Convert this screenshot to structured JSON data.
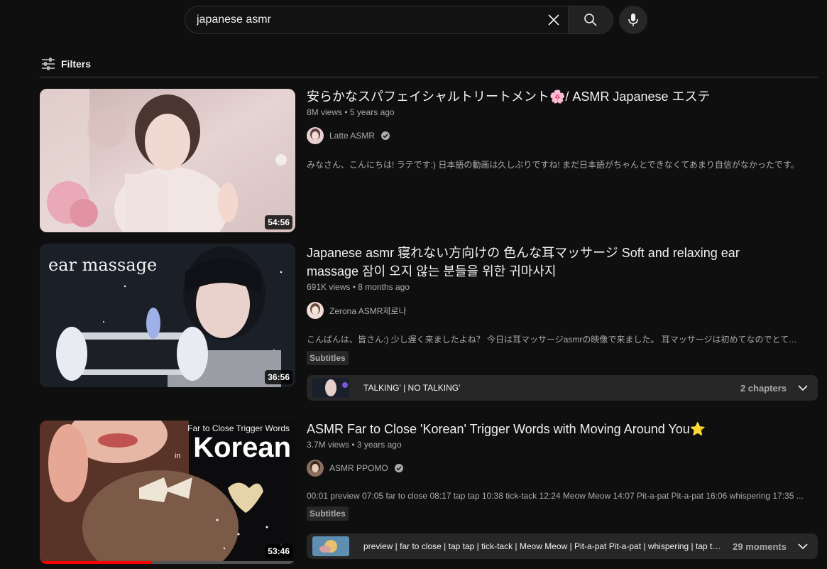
{
  "search": {
    "query": "japanese asmr"
  },
  "filters": {
    "label": "Filters"
  },
  "results": [
    {
      "title": "安らかなスパフェイシャルトリートメント🌸/ ASMR Japanese エステ",
      "views": "8M views",
      "age": "5 years ago",
      "channel": "Latte ASMR",
      "verified": true,
      "description": "みなさん、こんにちは! ラテです:) 日本語の動画は久しぶりですね! まだ日本語がちゃんとできなくてあまり自信がなかったです。",
      "duration": "54:56"
    },
    {
      "title": "Japanese asmr 寝れない方向けの 色んな耳マッサージ Soft and relaxing ear massage 잠이 오지 않는 분들을 위한 귀마사지",
      "views": "691K views",
      "age": "8 months ago",
      "channel": "Zerona ASMR제로나",
      "verified": false,
      "description": "こんばんは、皆さん:) 少し遅く来ましたよね？ 今日は耳マッサージasmrの映像で来ました。 耳マッサージは初めてなのでとても ...",
      "badge": "Subtitles",
      "thumb_text": "ear massage",
      "chapters_text": "TALKING' | NO TALKING'",
      "chapters_count": "2 chapters",
      "duration": "36:56"
    },
    {
      "title": "ASMR Far to Close 'Korean' Trigger Words with Moving Around You⭐",
      "views": "3.7M views",
      "age": "3 years ago",
      "channel": "ASMR PPOMO",
      "verified": true,
      "description": "00:01 preview 07:05 far to close 08:17 tap tap 10:38 tick-tack 12:24 Meow Meow 14:07 Pit-a-pat Pit-a-pat 16:06 whispering 17:35 ...",
      "badge": "Subtitles",
      "thumb_text_small": "Far to Close Trigger Words",
      "thumb_text_in": "in",
      "thumb_text_big": "Korean",
      "chapters_text": "preview | far to close | tap tap | tick-tack | Meow Meow | Pit-a-pat Pit-a-pat | whispering | tap tap tap tap",
      "chapters_count": "29 moments",
      "duration": "53:46",
      "watch_progress": 0.44
    }
  ]
}
